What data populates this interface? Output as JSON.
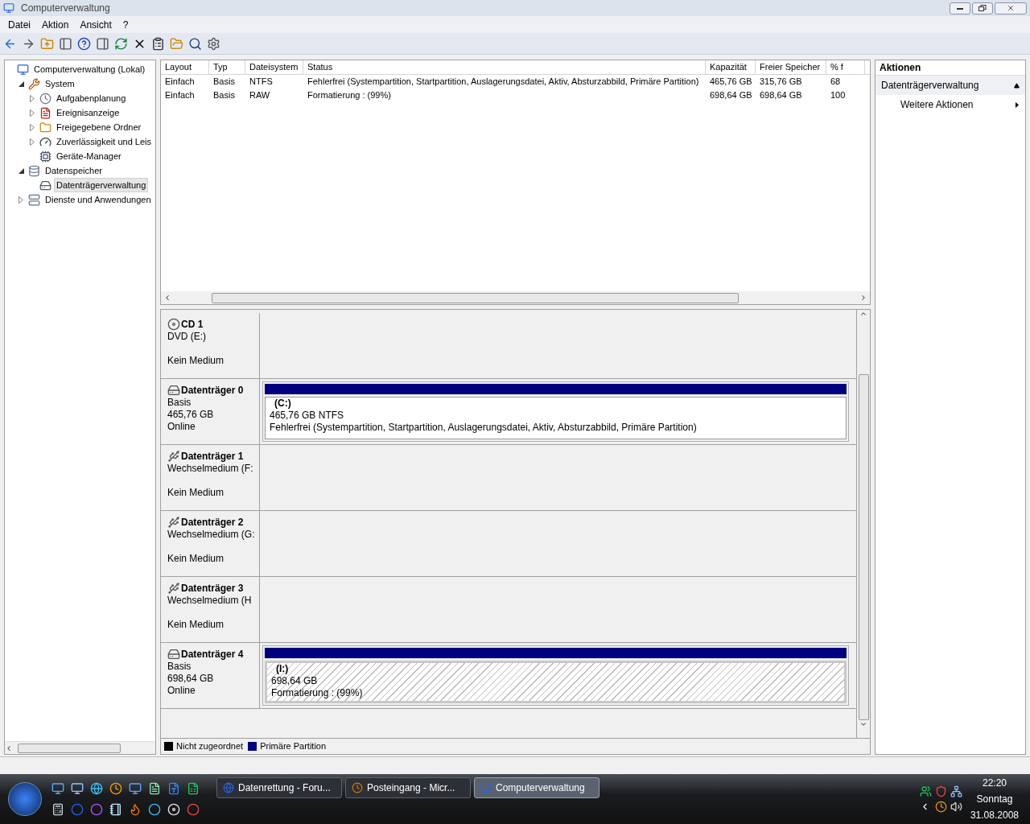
{
  "window": {
    "title": "Computerverwaltung"
  },
  "menu": [
    "Datei",
    "Aktion",
    "Ansicht",
    "?"
  ],
  "tree": [
    {
      "label": "Computerverwaltung (Lokal)",
      "selected": false,
      "children": [
        {
          "label": "System",
          "expanded": true,
          "selected": false,
          "children": [
            {
              "label": "Aufgabenplanung",
              "expanded": false,
              "selected": false
            },
            {
              "label": "Ereignisanzeige",
              "expanded": false,
              "selected": false
            },
            {
              "label": "Freigegebene Ordner",
              "expanded": false,
              "selected": false
            },
            {
              "label": "Zuverlässigkeit und Leis",
              "expanded": false,
              "selected": false
            },
            {
              "label": "Geräte-Manager",
              "selected": false
            }
          ]
        },
        {
          "label": "Datenspeicher",
          "expanded": true,
          "selected": false,
          "children": [
            {
              "label": "Datenträgerverwaltung",
              "selected": true
            }
          ]
        },
        {
          "label": "Dienste und Anwendungen",
          "expanded": false,
          "selected": false
        }
      ]
    }
  ],
  "table": {
    "columns": [
      "Layout",
      "Typ",
      "Dateisystem",
      "Status",
      "Kapazität",
      "Freier Speicher",
      "% f"
    ],
    "rows": [
      [
        "Einfach",
        "Basis",
        "NTFS",
        "Fehlerfrei (Systempartition, Startpartition, Auslagerungsdatei, Aktiv, Absturzabbild, Primäre Partition)",
        "465,76 GB",
        "315,76 GB",
        "68"
      ],
      [
        "Einfach",
        "Basis",
        "RAW",
        "Formatierung : (99%)",
        "698,64 GB",
        "698,64 GB",
        "100"
      ]
    ]
  },
  "disks": [
    {
      "kind": "cdrom",
      "name": "CD 1",
      "type": "DVD (E:)",
      "status": "Kein Medium"
    },
    {
      "kind": "hdd",
      "name": "Datenträger 0",
      "type": "Basis",
      "size": "465,76 GB",
      "status": "Online",
      "partition": {
        "kind": "healthy",
        "label": "(C:)",
        "size": "465,76 GB NTFS",
        "status": "Fehlerfrei (Systempartition, Startpartition, Auslagerungsdatei, Aktiv, Absturzabbild, Primäre Partition)"
      }
    },
    {
      "kind": "removable",
      "name": "Datenträger 1",
      "type": "Wechselmedium (F:",
      "status": "Kein Medium"
    },
    {
      "kind": "removable",
      "name": "Datenträger 2",
      "type": "Wechselmedium (G:",
      "status": "Kein Medium"
    },
    {
      "kind": "removable",
      "name": "Datenträger 3",
      "type": "Wechselmedium (H",
      "status": "Kein Medium"
    },
    {
      "kind": "hdd",
      "name": "Datenträger 4",
      "type": "Basis",
      "size": "698,64 GB",
      "status": "Online",
      "partition": {
        "kind": "formatting",
        "label": "(I:)",
        "size": "698,64 GB",
        "status": "Formatierung : (99%)"
      }
    }
  ],
  "legend": [
    {
      "label": "Nicht zugeordnet",
      "color": "#000000"
    },
    {
      "label": "Primäre Partition",
      "color": "#000080"
    }
  ],
  "actions": {
    "title": "Aktionen",
    "section": "Datenträgerverwaltung",
    "items": [
      "Weitere Aktionen"
    ]
  },
  "taskbar": {
    "tasks": [
      {
        "label": "Datenrettung - Foru...",
        "selected": false
      },
      {
        "label": "Posteingang - Micr...",
        "selected": false
      },
      {
        "label": "Computerverwaltung",
        "selected": true
      }
    ],
    "clock": {
      "time": "22:20",
      "day": "Sonntag",
      "date": "31.08.2008"
    }
  }
}
